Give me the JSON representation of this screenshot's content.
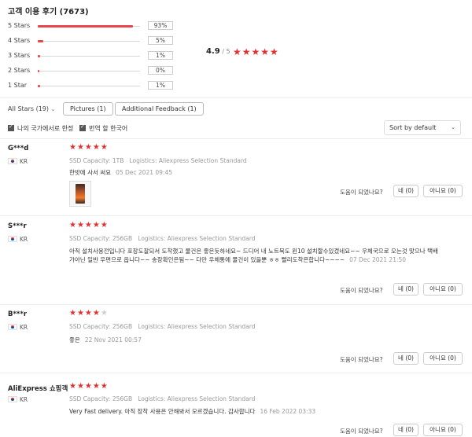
{
  "header": {
    "title": "고객 이용 후기 (7673)"
  },
  "distribution": [
    {
      "label": "5 Stars",
      "pct": "93%",
      "fill": 0.93
    },
    {
      "label": "4 Stars",
      "pct": "5%",
      "fill": 0.05
    },
    {
      "label": "3 Stars",
      "pct": "1%",
      "fill": 0.01
    },
    {
      "label": "2 Stars",
      "pct": "0%",
      "fill": 0.0
    },
    {
      "label": "1 Star",
      "pct": "1%",
      "fill": 0.01
    }
  ],
  "average": {
    "score": "4.9",
    "out_of": "/ 5",
    "stars": "★★★★★"
  },
  "filters": {
    "all_stars": "All Stars (19)",
    "chevron": "⌄",
    "pictures": "Pictures (1)",
    "additional": "Additional Feedback (1)",
    "check_country": "나의 국가에서로 한정",
    "check_translate": "번역 할 한국어",
    "sort": "Sort by default"
  },
  "reviews": [
    {
      "name": "G***d",
      "country": "KR",
      "stars": "★★★★★",
      "stars_off": "",
      "capacity_label": "SSD Capacity:",
      "capacity": "1TB",
      "logistics_label": "Logistics:",
      "logistics": "Aliexpress Selection Standard",
      "text": "한밧에 사서 써요",
      "date": "05 Dec 2021 09:45",
      "helpful": "도움이 되었나요?",
      "yes": "네 (0)",
      "no": "아니요 (0)"
    },
    {
      "name": "S***r",
      "country": "KR",
      "stars": "★★★★★",
      "stars_off": "",
      "capacity_label": "SSD Capacity:",
      "capacity": "256GB",
      "logistics_label": "Logistics:",
      "logistics": "Aliexpress Selection Standard",
      "text": "아직 설치사용전입니다 포장도잘되서 도착했고 물건은 좋은듯하네요~ 드디어 내 노트북도 윈10 설치할수있겠네요~~ 우체국으로 오는것 맞으나 택배가아닌 일반 우편으로 옵니다~~ 송장확인은됨~~ 다만 우체통에 물건이 있을뿐 ㅎㅎ 빨리도착은합니다~~~~",
      "date": "07 Dec 2021 21:50",
      "helpful": "도움이 되었나요?",
      "yes": "네 (0)",
      "no": "아니요 (0)"
    },
    {
      "name": "B***r",
      "country": "KR",
      "stars": "★★★★",
      "stars_off": "★",
      "capacity_label": "SSD Capacity:",
      "capacity": "256GB",
      "logistics_label": "Logistics:",
      "logistics": "Aliexpress Selection Standard",
      "text": "좋은",
      "date": "22 Nov 2021 00:57",
      "helpful": "도움이 되었나요?",
      "yes": "네 (0)",
      "no": "아니요 (0)"
    },
    {
      "name": "AliExpress 쇼핑객",
      "country": "KR",
      "stars": "★★★★★",
      "stars_off": "",
      "capacity_label": "SSD Capacity:",
      "capacity": "256GB",
      "logistics_label": "Logistics:",
      "logistics": "Aliexpress Selection Standard",
      "text": "Very Fast delivery. 아직 장착 사용은 안해봐서 모르겠습니다. 감사합니다",
      "date": "16 Feb 2022 03:33",
      "helpful": "도움이 되었나요?",
      "yes": "네 (0)",
      "no": "아니요 (0)"
    }
  ]
}
